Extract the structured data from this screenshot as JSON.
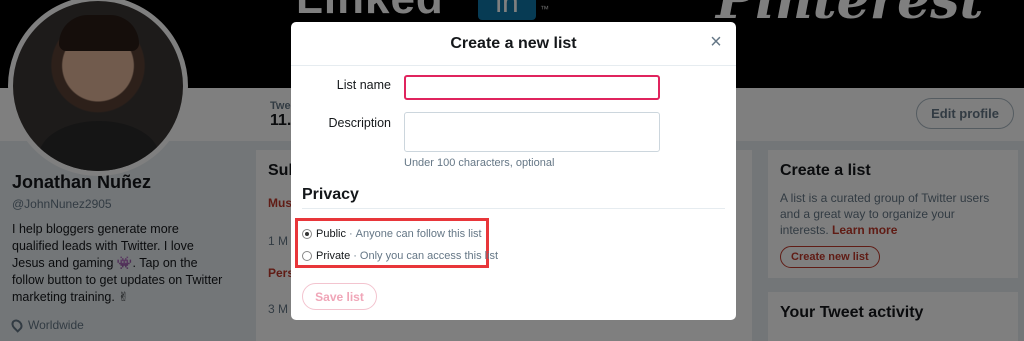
{
  "banner": {
    "left_brand": "Linked",
    "left_brand_box": "in",
    "left_brand_mark": "™",
    "right_brand": "Pinterest"
  },
  "profile_nav": {
    "tweets_label": "Twee",
    "tweets_value": "11..",
    "edit_profile_label": "Edit profile"
  },
  "profile": {
    "name": "Jonathan Nuñez",
    "handle": "@JohnNunez2905",
    "bio": "I help bloggers generate more qualified leads with Twitter. I love Jesus and gaming 👾. Tap on the follow button to get updates on Twitter marketing training. ✌",
    "location": "Worldwide"
  },
  "middle": {
    "title": "Sub",
    "items": [
      {
        "text": "Mus",
        "style": "red"
      },
      {
        "text": "1 M",
        "style": "muted"
      },
      {
        "text": "Pers",
        "style": "red"
      },
      {
        "text": "3 M",
        "style": "muted"
      }
    ]
  },
  "right_panel": {
    "create_list_title": "Create a list",
    "create_list_text": "A list is a curated group of Twitter users and a great way to organize your interests.",
    "learn_more": "Learn more",
    "create_list_button": "Create new list",
    "activity_title": "Your Tweet activity"
  },
  "modal": {
    "title": "Create a new list",
    "close_symbol": "×",
    "list_name_label": "List name",
    "list_name_value": "",
    "description_label": "Description",
    "description_value": "",
    "description_hint": "Under 100 characters, optional",
    "privacy_title": "Privacy",
    "options": [
      {
        "label": "Public",
        "desc": "Anyone can follow this list",
        "checked": true
      },
      {
        "label": "Private",
        "desc": "Only you can access this list",
        "checked": false
      }
    ],
    "separator": "·",
    "save_label": "Save list",
    "highlight_color": "#e8363a",
    "accent_color": "#e0245e"
  }
}
